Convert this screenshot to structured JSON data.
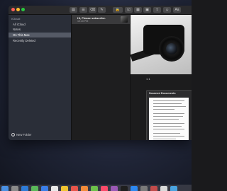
{
  "sidebar": {
    "section": "iCloud",
    "items": [
      {
        "label": "All iCloud"
      },
      {
        "label": "Notes"
      },
      {
        "label": "On This Mac"
      },
      {
        "label": "Recently Deleted"
      }
    ],
    "selected_index": 2,
    "new_folder_label": "New Folder"
  },
  "note_list": {
    "notes": [
      {
        "title": "Hi, Please subscribe.",
        "time": "10:40 PM"
      }
    ]
  },
  "editor": {
    "caption": "1 1",
    "attachment_title": "Scanned Documents"
  },
  "colors": {
    "sidebar_bg": "#2a2e38",
    "selected": "#555a66",
    "window_bg": "#1e1e1e"
  }
}
